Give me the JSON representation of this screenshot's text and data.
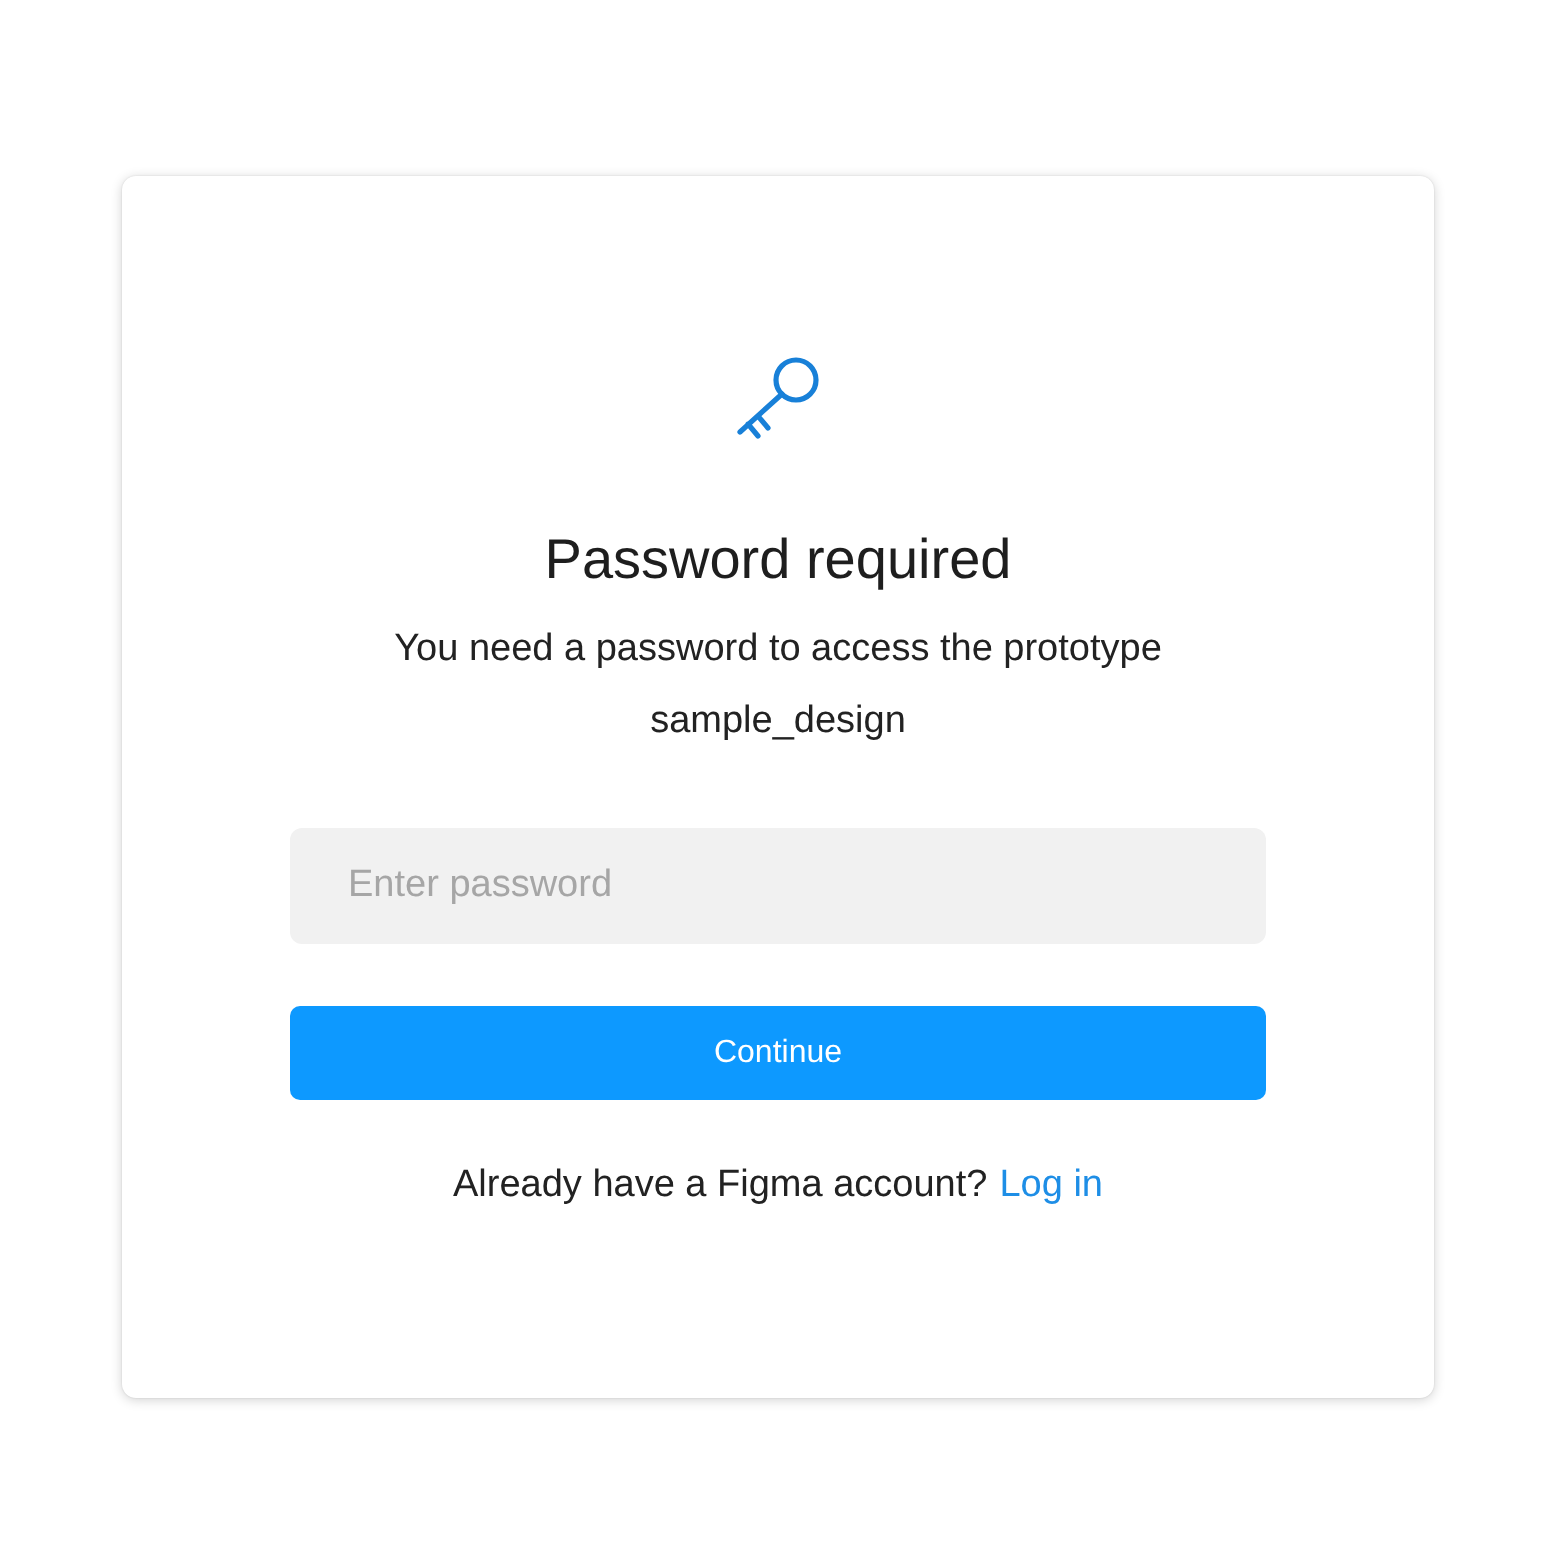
{
  "dialog": {
    "title": "Password required",
    "message": "You need a password to access the prototype",
    "file_name": "sample_design",
    "password_field": {
      "placeholder": "Enter password"
    },
    "button": "Continue",
    "footer": {
      "text": "Already have a Figma account?",
      "link": "Log in"
    }
  }
}
